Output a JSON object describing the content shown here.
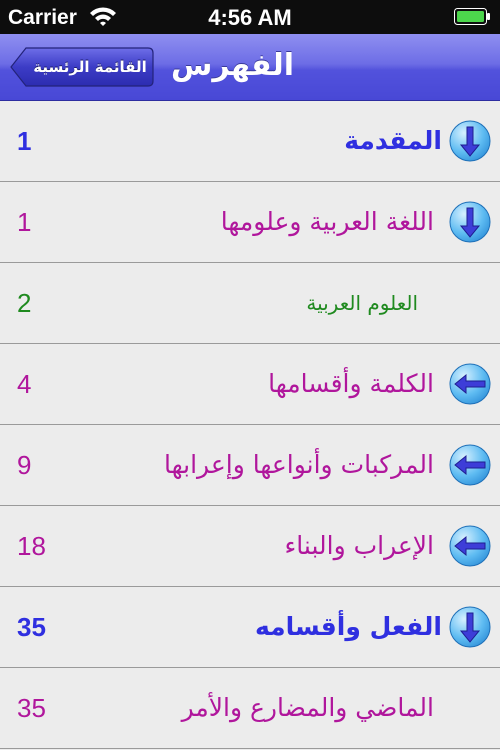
{
  "status": {
    "carrier": "Carrier",
    "time": "4:56 AM"
  },
  "nav": {
    "title": "الفهرس",
    "back_label": "القائمة الرئسية"
  },
  "colors": {
    "nav": "#5a5ae0",
    "blue": "#2f2fe0",
    "magenta": "#b0169c",
    "green": "#1f8a1f"
  },
  "rows": [
    {
      "title": "المقدمة",
      "page": "1",
      "icon": "arrow-down-icon"
    },
    {
      "title": "اللغة العربية وعلومها",
      "page": "1",
      "icon": "arrow-down-icon"
    },
    {
      "title": "العلوم العربية",
      "page": "2",
      "icon": "none"
    },
    {
      "title": "الكلمة وأقسامها",
      "page": "4",
      "icon": "arrow-left-icon"
    },
    {
      "title": "المركبات وأنواعها وإعرابها",
      "page": "9",
      "icon": "arrow-left-icon"
    },
    {
      "title": "الإعراب والبناء",
      "page": "18",
      "icon": "arrow-left-icon"
    },
    {
      "title": "الفعل وأقسامه",
      "page": "35",
      "icon": "arrow-down-icon"
    },
    {
      "title": "الماضي والمضارع والأمر",
      "page": "35",
      "icon": "none"
    }
  ]
}
